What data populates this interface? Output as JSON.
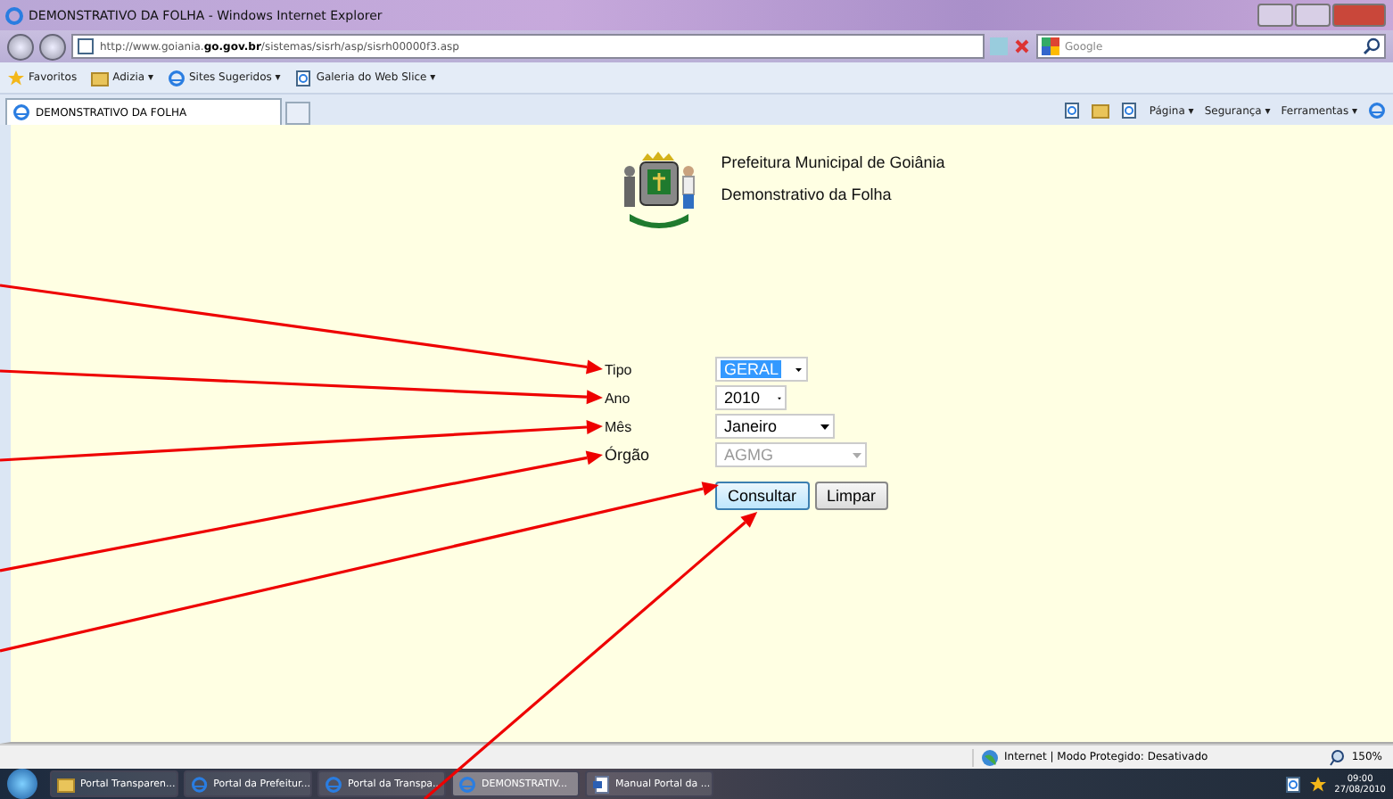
{
  "window": {
    "title": "DEMONSTRATIVO DA FOLHA - Windows Internet Explorer"
  },
  "address_bar": {
    "url": "http://www.goiania.**go.gov.br**/sistemas/sisrh/asp/sisrh00000f3.asp",
    "search_placeholder": "Google"
  },
  "favorites_bar": {
    "items": [
      {
        "label": "Favoritos",
        "kind": "star"
      },
      {
        "label": "Adizia ▾",
        "kind": "folder"
      },
      {
        "label": "Sites Sugeridos ▾",
        "kind": "ie"
      },
      {
        "label": "Galeria do Web Slice ▾",
        "kind": "page"
      }
    ]
  },
  "tabs": [
    {
      "label": "DEMONSTRATIVO DA FOLHA",
      "selected": true
    }
  ],
  "command_bar": [
    "Página ▾",
    "Segurança ▾",
    "Ferramentas ▾"
  ],
  "page": {
    "header": [
      "Prefeitura Municipal de Goiânia",
      "Demonstrativo da Folha"
    ],
    "fields": [
      {
        "label": "Tipo",
        "value": "GERAL",
        "focused": true,
        "disabled": false,
        "annotated": true
      },
      {
        "label": "Ano",
        "value": "2010",
        "focused": false,
        "disabled": false,
        "annotated": true
      },
      {
        "label": "Mês",
        "value": "Janeiro",
        "focused": false,
        "disabled": false,
        "annotated": true
      },
      {
        "label": "Órgão",
        "value": "AGMG",
        "focused": false,
        "disabled": true,
        "annotated": true
      }
    ],
    "buttons": [
      {
        "label": "Consultar",
        "focused": true,
        "annotated": true
      },
      {
        "label": "Limpar",
        "focused": false,
        "annotated": false
      }
    ]
  },
  "status_bar": {
    "zone": "Internet | Modo Protegido: Desativado",
    "zoom": "150%"
  },
  "taskbar": {
    "items": [
      {
        "label": "Portal Transparen...",
        "kind": "folder",
        "selected": false
      },
      {
        "label": "Portal da Prefeitur...",
        "kind": "ie",
        "selected": false
      },
      {
        "label": "Portal da Transpa...",
        "kind": "ie",
        "selected": false
      },
      {
        "label": "DEMONSTRATIV...",
        "kind": "ie",
        "selected": true
      },
      {
        "label": "Manual Portal da ...",
        "kind": "word",
        "selected": false
      }
    ],
    "time": "09:00",
    "date": "27/08/2010"
  }
}
